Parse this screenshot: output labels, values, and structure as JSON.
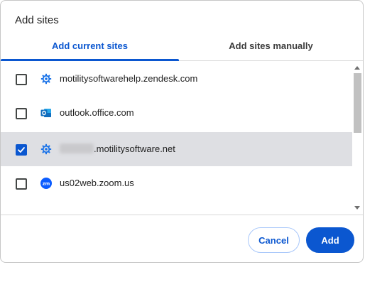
{
  "dialog": {
    "title": "Add sites"
  },
  "tabs": [
    {
      "label": "Add current sites",
      "active": true
    },
    {
      "label": "Add sites manually",
      "active": false
    }
  ],
  "sites": [
    {
      "domain": "motilitysoftwarehelp.zendesk.com",
      "checked": false,
      "icon": "gear-icon"
    },
    {
      "domain": "outlook.office.com",
      "checked": false,
      "icon": "outlook-icon"
    },
    {
      "domain": ".motilitysoftware.net",
      "checked": true,
      "icon": "gear-icon",
      "redacted_prefix": true
    },
    {
      "domain": "us02web.zoom.us",
      "checked": false,
      "icon": "zoom-icon"
    }
  ],
  "buttons": {
    "cancel_label": "Cancel",
    "add_label": "Add"
  },
  "colors": {
    "accent": "#0b57d0",
    "selected_row": "#dedfe3",
    "outlook_blue": "#0f6cbd",
    "zoom_blue": "#0b5cff",
    "gear_blue": "#1a73e8"
  }
}
